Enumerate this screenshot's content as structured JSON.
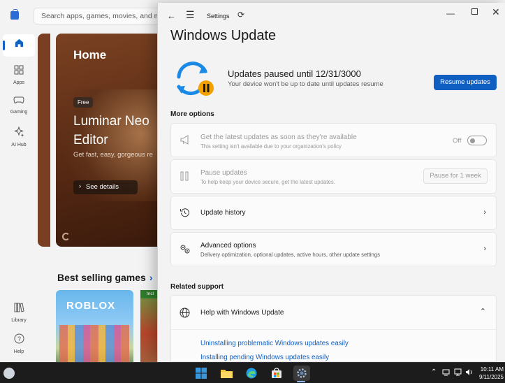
{
  "store": {
    "search_placeholder": "Search apps, games, movies, and more",
    "nav": [
      {
        "label": "",
        "icon": "home-icon"
      },
      {
        "label": "Apps",
        "icon": "apps-icon"
      },
      {
        "label": "Gaming",
        "icon": "gamepad-icon"
      },
      {
        "label": "AI Hub",
        "icon": "ai-hub-icon"
      },
      {
        "label": "Library",
        "icon": "library-icon"
      },
      {
        "label": "Help",
        "icon": "help-icon"
      }
    ],
    "hero": {
      "title": "Home",
      "badge": "Free",
      "game_title": "Luminar Neo Editor",
      "subtitle": "Get fast, easy, gorgeous re",
      "button": "See details"
    },
    "best_selling": "Best selling games",
    "games": [
      {
        "name": "ROBLOX"
      },
      {
        "tag": "Incl"
      }
    ]
  },
  "settings": {
    "app_title": "Settings",
    "page_title": "Windows Update",
    "status": {
      "title": "Updates paused until 12/31/3000",
      "subtitle": "Your device won't be up to date until updates resume",
      "button": "Resume updates"
    },
    "more_options": "More options",
    "options": [
      {
        "title": "Get the latest updates as soon as they're available",
        "subtitle": "This setting isn't available due to your organization's policy",
        "control": "Off",
        "icon": "megaphone-icon"
      },
      {
        "title": "Pause updates",
        "subtitle": "To help keep your device secure, get the latest updates.",
        "control": "Pause for 1 week",
        "icon": "pause-icon"
      },
      {
        "title": "Update history",
        "subtitle": "",
        "icon": "history-icon"
      },
      {
        "title": "Advanced options",
        "subtitle": "Delivery optimization, optional updates, active hours, other update settings",
        "icon": "gears-icon"
      }
    ],
    "related_support": "Related support",
    "help": {
      "title": "Help with Windows Update",
      "links": [
        "Uninstalling problematic Windows updates easily",
        "Installing pending Windows updates easily"
      ]
    }
  },
  "taskbar": {
    "time": "10:11 AM",
    "date": "9/11/2025"
  },
  "colors": {
    "accent": "#0f5fc3",
    "pause_badge": "#f2a100",
    "sync_blue": "#1a8ae6"
  }
}
